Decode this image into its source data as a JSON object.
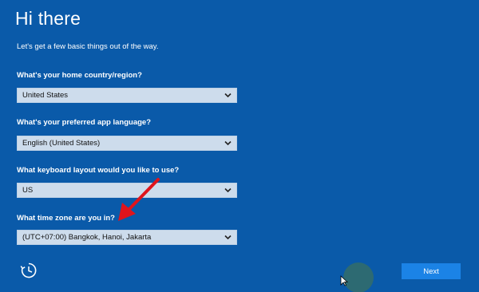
{
  "header": {
    "title": "Hi there",
    "subtitle": "Let's get a few basic things out of the way."
  },
  "fields": [
    {
      "label": "What's your home country/region?",
      "value": "United States"
    },
    {
      "label": "What's your preferred app language?",
      "value": "English (United States)"
    },
    {
      "label": "What keyboard layout would you like to use?",
      "value": "US"
    },
    {
      "label": "What time zone are you in?",
      "value": "(UTC+07:00) Bangkok, Hanoi, Jakarta"
    }
  ],
  "footer": {
    "next_label": "Next",
    "accessibility_icon": "ease-of-access-icon"
  },
  "colors": {
    "background": "#0a5aa9",
    "dropdown": "#cddcec",
    "next_button": "#1b83e6",
    "annotation_arrow": "#e0141c"
  }
}
